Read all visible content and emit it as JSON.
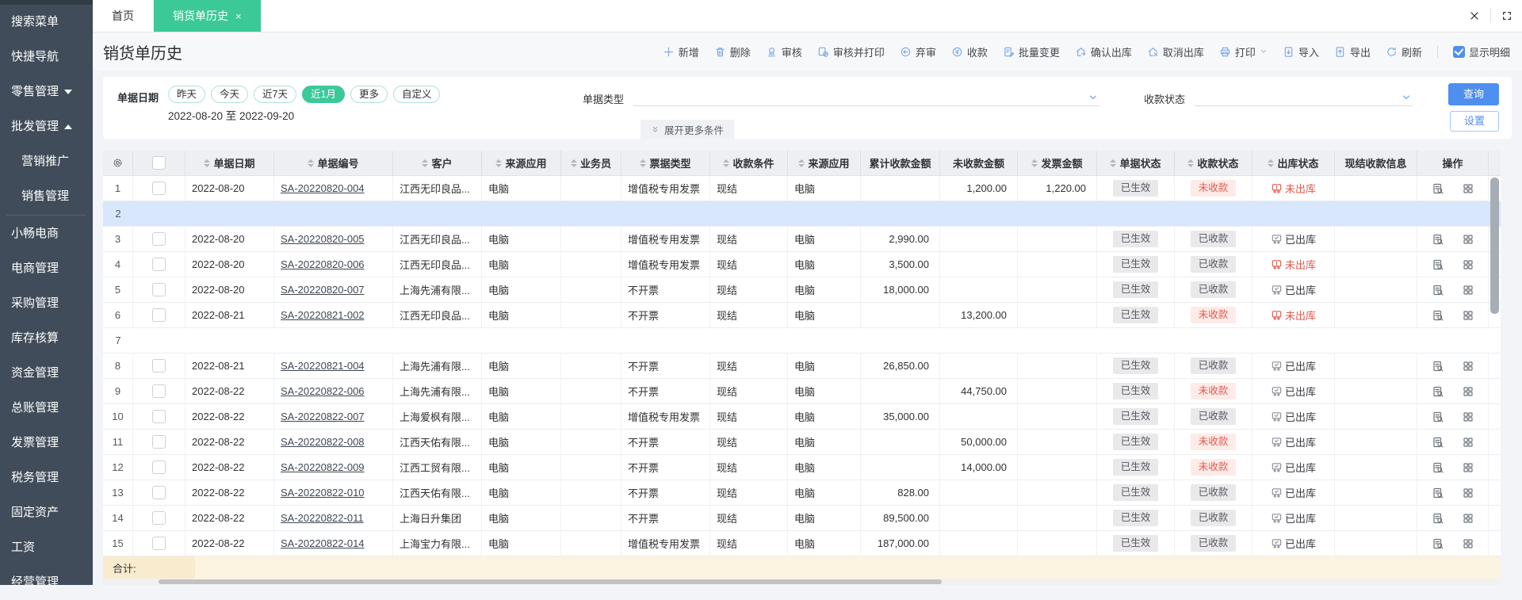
{
  "page": {
    "title": "销货单历史"
  },
  "tabs": [
    {
      "label": "首页",
      "active": false
    },
    {
      "label": "销货单历史",
      "active": true,
      "closable": true
    }
  ],
  "window_icons": {
    "close": "×",
    "fullscreen": "[ ]"
  },
  "sidebar": {
    "items": [
      {
        "label": "搜索菜单"
      },
      {
        "label": "快捷导航"
      },
      {
        "label": "零售管理",
        "arrow": "down"
      },
      {
        "label": "批发管理",
        "arrow": "up"
      },
      {
        "label": "营销推广",
        "sub": true
      },
      {
        "label": "销售管理",
        "sub": true,
        "divider_after": true
      },
      {
        "label": "小畅电商"
      },
      {
        "label": "电商管理"
      },
      {
        "label": "采购管理"
      },
      {
        "label": "库存核算"
      },
      {
        "label": "资金管理"
      },
      {
        "label": "总账管理"
      },
      {
        "label": "发票管理"
      },
      {
        "label": "税务管理"
      },
      {
        "label": "固定资产"
      },
      {
        "label": "工资"
      },
      {
        "label": "经营管理"
      }
    ]
  },
  "toolbar": {
    "items": [
      {
        "label": "新增",
        "icon": "plus"
      },
      {
        "label": "删除",
        "icon": "trash"
      },
      {
        "label": "审核",
        "icon": "audit"
      },
      {
        "label": "审核并打印",
        "icon": "audit-print"
      },
      {
        "label": "弃审",
        "icon": "discard"
      },
      {
        "label": "收款",
        "icon": "collect"
      },
      {
        "label": "批量变更",
        "icon": "batch-change"
      },
      {
        "label": "确认出库",
        "icon": "confirm-outbound"
      },
      {
        "label": "取消出库",
        "icon": "cancel-outbound"
      },
      {
        "label": "打印",
        "icon": "print",
        "caret": true
      },
      {
        "label": "导入",
        "icon": "import"
      },
      {
        "label": "导出",
        "icon": "export"
      },
      {
        "label": "刷新",
        "icon": "refresh"
      }
    ],
    "show_detail_label": "显示明细",
    "show_detail_checked": true
  },
  "filters": {
    "date_label": "单据日期",
    "date_pills": [
      {
        "label": "昨天"
      },
      {
        "label": "今天"
      },
      {
        "label": "近7天"
      },
      {
        "label": "近1月",
        "active": true
      },
      {
        "label": "更多"
      },
      {
        "label": "自定义"
      }
    ],
    "date_range": "2022-08-20 至 2022-09-20",
    "doc_type_label": "单据类型",
    "payment_status_label": "收款状态",
    "search_button": "查询",
    "settings_button": "设置",
    "expand_more": "展开更多条件"
  },
  "table": {
    "columns": [
      {
        "type": "gear",
        "label": ""
      },
      {
        "type": "checkbox",
        "label": ""
      },
      {
        "label": "单据日期",
        "sortable": true
      },
      {
        "label": "单据编号",
        "sortable": true
      },
      {
        "label": "客户",
        "sortable": true
      },
      {
        "label": "来源应用",
        "sortable": true
      },
      {
        "label": "业务员",
        "sortable": true
      },
      {
        "label": "票据类型",
        "sortable": true
      },
      {
        "label": "收款条件",
        "sortable": true
      },
      {
        "label": "来源应用",
        "sortable": true
      },
      {
        "label": "累计收款金额",
        "sortable": false
      },
      {
        "label": "未收款金额",
        "sortable": false
      },
      {
        "label": "发票金额",
        "sortable": true
      },
      {
        "label": "单据状态",
        "sortable": true
      },
      {
        "label": "收款状态",
        "sortable": true
      },
      {
        "label": "出库状态",
        "sortable": true
      },
      {
        "label": "现结收款信息",
        "sortable": false
      },
      {
        "label": "操作",
        "sortable": false
      }
    ],
    "rows": [
      {
        "num": "1",
        "date": "2022-08-20",
        "doc_no": "SA-20220820-004",
        "customer": "江西无印良品...",
        "source_app": "电脑",
        "salesperson": "",
        "invoice_type": "增值税专用发票",
        "payment_terms": "现结",
        "source_app2": "电脑",
        "received_total": "",
        "unreceived": "1,200.00",
        "invoice_amount": "1,220.00",
        "doc_status": "已生效",
        "payment_status": "未收款",
        "payment_alert": true,
        "outbound_status": "未出库",
        "outbound_alert": true,
        "cash_info": ""
      },
      {
        "num": "2",
        "empty": true,
        "selected": true
      },
      {
        "num": "3",
        "date": "2022-08-20",
        "doc_no": "SA-20220820-005",
        "customer": "江西无印良品...",
        "source_app": "电脑",
        "salesperson": "",
        "invoice_type": "增值税专用发票",
        "payment_terms": "现结",
        "source_app2": "电脑",
        "received_total": "2,990.00",
        "unreceived": "",
        "invoice_amount": "",
        "doc_status": "已生效",
        "payment_status": "已收款",
        "payment_alert": false,
        "outbound_status": "已出库",
        "outbound_alert": false,
        "cash_info": ""
      },
      {
        "num": "4",
        "date": "2022-08-20",
        "doc_no": "SA-20220820-006",
        "customer": "江西无印良品...",
        "source_app": "电脑",
        "salesperson": "",
        "invoice_type": "增值税专用发票",
        "payment_terms": "现结",
        "source_app2": "电脑",
        "received_total": "3,500.00",
        "unreceived": "",
        "invoice_amount": "",
        "doc_status": "已生效",
        "payment_status": "已收款",
        "payment_alert": false,
        "outbound_status": "未出库",
        "outbound_alert": true,
        "cash_info": ""
      },
      {
        "num": "5",
        "date": "2022-08-20",
        "doc_no": "SA-20220820-007",
        "customer": "上海先浦有限...",
        "source_app": "电脑",
        "salesperson": "",
        "invoice_type": "不开票",
        "payment_terms": "现结",
        "source_app2": "电脑",
        "received_total": "18,000.00",
        "unreceived": "",
        "invoice_amount": "",
        "doc_status": "已生效",
        "payment_status": "已收款",
        "payment_alert": false,
        "outbound_status": "已出库",
        "outbound_alert": false,
        "cash_info": ""
      },
      {
        "num": "6",
        "date": "2022-08-21",
        "doc_no": "SA-20220821-002",
        "customer": "江西无印良品...",
        "source_app": "电脑",
        "salesperson": "",
        "invoice_type": "不开票",
        "payment_terms": "现结",
        "source_app2": "电脑",
        "received_total": "",
        "unreceived": "13,200.00",
        "invoice_amount": "",
        "doc_status": "已生效",
        "payment_status": "未收款",
        "payment_alert": true,
        "outbound_status": "未出库",
        "outbound_alert": true,
        "cash_info": ""
      },
      {
        "num": "7",
        "empty": true
      },
      {
        "num": "8",
        "date": "2022-08-21",
        "doc_no": "SA-20220821-004",
        "customer": "上海先浦有限...",
        "source_app": "电脑",
        "salesperson": "",
        "invoice_type": "不开票",
        "payment_terms": "现结",
        "source_app2": "电脑",
        "received_total": "26,850.00",
        "unreceived": "",
        "invoice_amount": "",
        "doc_status": "已生效",
        "payment_status": "已收款",
        "payment_alert": false,
        "outbound_status": "已出库",
        "outbound_alert": false,
        "cash_info": ""
      },
      {
        "num": "9",
        "date": "2022-08-22",
        "doc_no": "SA-20220822-006",
        "customer": "上海先浦有限...",
        "source_app": "电脑",
        "salesperson": "",
        "invoice_type": "不开票",
        "payment_terms": "现结",
        "source_app2": "电脑",
        "received_total": "",
        "unreceived": "44,750.00",
        "invoice_amount": "",
        "doc_status": "已生效",
        "payment_status": "未收款",
        "payment_alert": true,
        "outbound_status": "已出库",
        "outbound_alert": false,
        "cash_info": ""
      },
      {
        "num": "10",
        "date": "2022-08-22",
        "doc_no": "SA-20220822-007",
        "customer": "上海爱枫有限...",
        "source_app": "电脑",
        "salesperson": "",
        "invoice_type": "增值税专用发票",
        "payment_terms": "现结",
        "source_app2": "电脑",
        "received_total": "35,000.00",
        "unreceived": "",
        "invoice_amount": "",
        "doc_status": "已生效",
        "payment_status": "已收款",
        "payment_alert": false,
        "outbound_status": "已出库",
        "outbound_alert": false,
        "cash_info": ""
      },
      {
        "num": "11",
        "date": "2022-08-22",
        "doc_no": "SA-20220822-008",
        "customer": "江西天佑有限...",
        "source_app": "电脑",
        "salesperson": "",
        "invoice_type": "不开票",
        "payment_terms": "现结",
        "source_app2": "电脑",
        "received_total": "",
        "unreceived": "50,000.00",
        "invoice_amount": "",
        "doc_status": "已生效",
        "payment_status": "未收款",
        "payment_alert": true,
        "outbound_status": "已出库",
        "outbound_alert": false,
        "cash_info": ""
      },
      {
        "num": "12",
        "date": "2022-08-22",
        "doc_no": "SA-20220822-009",
        "customer": "江西工贸有限...",
        "source_app": "电脑",
        "salesperson": "",
        "invoice_type": "不开票",
        "payment_terms": "现结",
        "source_app2": "电脑",
        "received_total": "",
        "unreceived": "14,000.00",
        "invoice_amount": "",
        "doc_status": "已生效",
        "payment_status": "未收款",
        "payment_alert": true,
        "outbound_status": "已出库",
        "outbound_alert": false,
        "cash_info": ""
      },
      {
        "num": "13",
        "date": "2022-08-22",
        "doc_no": "SA-20220822-010",
        "customer": "江西天佑有限...",
        "source_app": "电脑",
        "salesperson": "",
        "invoice_type": "不开票",
        "payment_terms": "现结",
        "source_app2": "电脑",
        "received_total": "828.00",
        "unreceived": "",
        "invoice_amount": "",
        "doc_status": "已生效",
        "payment_status": "已收款",
        "payment_alert": false,
        "outbound_status": "已出库",
        "outbound_alert": false,
        "cash_info": ""
      },
      {
        "num": "14",
        "date": "2022-08-22",
        "doc_no": "SA-20220822-011",
        "customer": "上海日升集团",
        "source_app": "电脑",
        "salesperson": "",
        "invoice_type": "不开票",
        "payment_terms": "现结",
        "source_app2": "电脑",
        "received_total": "89,500.00",
        "unreceived": "",
        "invoice_amount": "",
        "doc_status": "已生效",
        "payment_status": "已收款",
        "payment_alert": false,
        "outbound_status": "已出库",
        "outbound_alert": false,
        "cash_info": ""
      },
      {
        "num": "15",
        "date": "2022-08-22",
        "doc_no": "SA-20220822-014",
        "customer": "上海宝力有限...",
        "source_app": "电脑",
        "salesperson": "",
        "invoice_type": "增值税专用发票",
        "payment_terms": "现结",
        "source_app2": "电脑",
        "received_total": "187,000.00",
        "unreceived": "",
        "invoice_amount": "",
        "doc_status": "已生效",
        "payment_status": "已收款",
        "payment_alert": false,
        "outbound_status": "已出库",
        "outbound_alert": false,
        "cash_info": ""
      }
    ],
    "footer_label": "合计:"
  },
  "colors": {
    "accent_green": "#3cc998",
    "accent_blue": "#4e8ff0",
    "alert_red": "#e15a4c",
    "sidebar_bg": "#404c59",
    "selected_row_bg": "#d8e7fb",
    "footer_bg": "#fcf4e0",
    "table_header_bg": "#edeff3"
  }
}
